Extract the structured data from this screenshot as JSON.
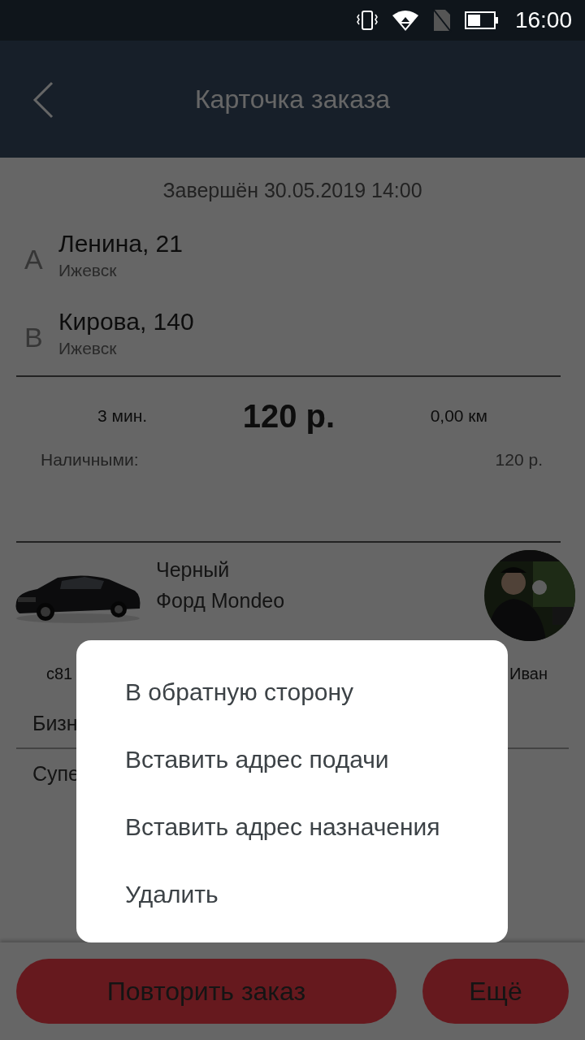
{
  "status_bar": {
    "time": "16:00"
  },
  "app_bar": {
    "title": "Карточка заказа"
  },
  "order": {
    "status": "Завершён 30.05.2019  14:00",
    "route": [
      {
        "letter": "A",
        "street": "Ленина, 21",
        "city": "Ижевск"
      },
      {
        "letter": "B",
        "street": "Кирова, 140",
        "city": "Ижевск"
      }
    ],
    "duration": "3 мин.",
    "price": "120 р.",
    "distance": "0,00 км",
    "payment_label": "Наличными:",
    "payment_amount": "120 р."
  },
  "car": {
    "color_name": "Черный",
    "model": "Форд Mondeo",
    "plate": "с81",
    "driver": "Иван"
  },
  "tariffs": [
    "Бизн",
    "Супе"
  ],
  "menu": {
    "items": [
      "В обратную сторону",
      "Вставить адрес подачи",
      "Вставить адрес назначения",
      "Удалить"
    ]
  },
  "buttons": [
    {
      "label": "Повторить заказ",
      "kind": "wide"
    },
    {
      "label": "Ещё",
      "kind": "narrow"
    }
  ]
}
